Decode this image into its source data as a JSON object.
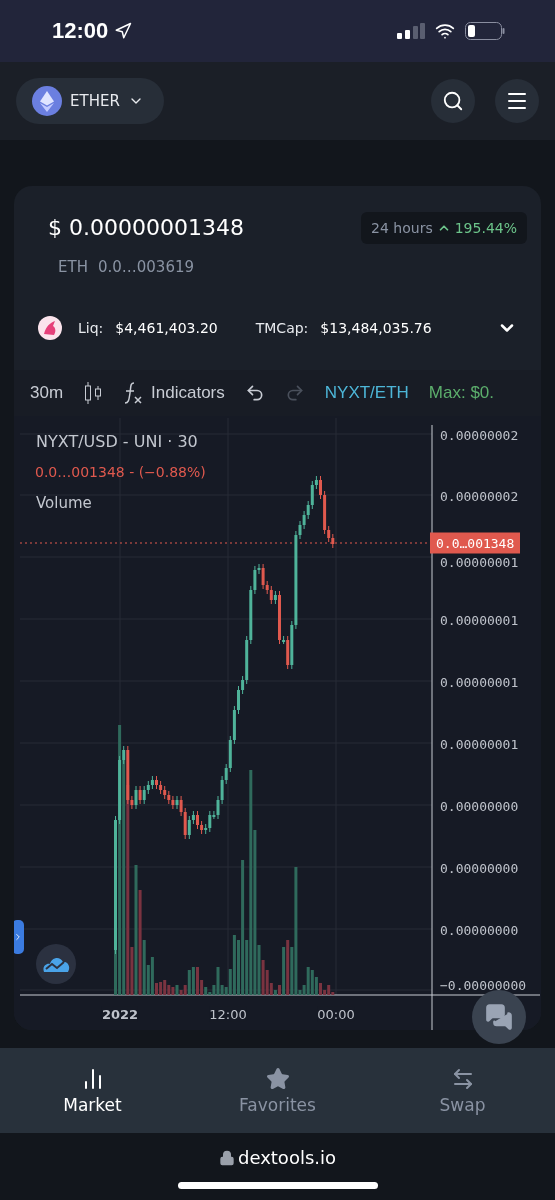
{
  "status_bar": {
    "time": "12:00"
  },
  "header": {
    "network": "ETHER"
  },
  "price": {
    "usd": "$ 0.00000001348",
    "change_label": "24 hours",
    "change": "195.44%",
    "eth_label": "ETH",
    "eth_value": "0.0…003619"
  },
  "stats": [
    {
      "label": "Liq:",
      "value": "$4,461,403.20"
    },
    {
      "label": "TMCap:",
      "value": "$13,484,035.76"
    }
  ],
  "toolbar": {
    "interval": "30m",
    "indicators": "Indicators",
    "pair": "NYXT/ETH",
    "max": "Max: $0."
  },
  "chart": {
    "title": "NYXT/USD - UNI · 30",
    "quote": "0.0…001348 - (−0.88%)",
    "volume_label": "Volume",
    "last_price": "0.0…001348",
    "price_axis": [
      "0.00000002",
      "0.00000002",
      "0.00000001",
      "0.00000001",
      "0.00000001",
      "0.00000001",
      "0.00000000",
      "0.00000000",
      "0.00000000",
      "−0.00000000"
    ],
    "time_axis": [
      "2022",
      "12:00",
      "00:00"
    ]
  },
  "nav": [
    {
      "label": "Market",
      "selected": true
    },
    {
      "label": "Favorites",
      "selected": false
    },
    {
      "label": "Swap",
      "selected": false
    }
  ],
  "url": "dextools.io"
}
